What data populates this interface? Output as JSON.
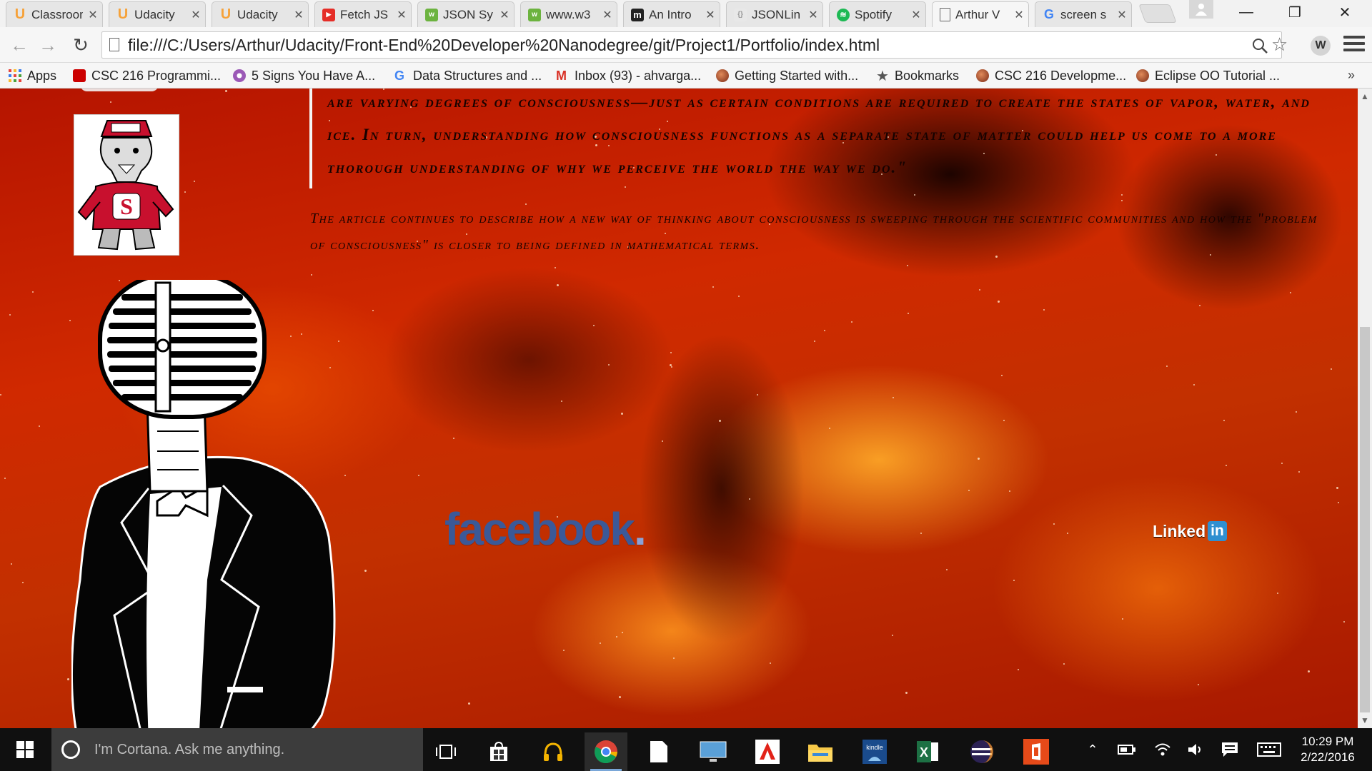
{
  "browser": {
    "tabs": [
      {
        "title": "Classroom",
        "icon": "udacity-icon",
        "color": "#f6a23a"
      },
      {
        "title": "Udacity",
        "icon": "udacity-icon",
        "color": "#f6a23a"
      },
      {
        "title": "Udacity",
        "icon": "udacity-icon",
        "color": "#f6a23a"
      },
      {
        "title": "Fetch JS",
        "icon": "youtube-icon",
        "color": "#e52d27"
      },
      {
        "title": "JSON Sy",
        "icon": "w3schools-icon",
        "color": "#6cb33f"
      },
      {
        "title": "www.w3",
        "icon": "w3schools-icon",
        "color": "#6cb33f"
      },
      {
        "title": "An Intro",
        "icon": "medium-icon",
        "color": "#222222"
      },
      {
        "title": "JSONLin",
        "icon": "jsonlint-icon",
        "color": "#cfcfcf"
      },
      {
        "title": "Spotify",
        "icon": "spotify-icon",
        "color": "#1db954"
      },
      {
        "title": "Arthur V",
        "icon": "page-icon",
        "color": "#ffffff",
        "active": true
      },
      {
        "title": "screen s",
        "icon": "google-icon",
        "color": "#4285f4"
      }
    ],
    "url": "file:///C:/Users/Arthur/Udacity/Front-End%20Developer%20Nanodegree/git/Project1/Portfolio/index.html",
    "bookmarks": [
      {
        "label": "Apps",
        "icon": "apps-grid-icon",
        "color": "#e8453c"
      },
      {
        "label": "CSC 216 Programmi...",
        "icon": "ncsu-icon",
        "color": "#cc0000"
      },
      {
        "label": "5 Signs You Have A...",
        "icon": "flower-icon",
        "color": "#9b59b6"
      },
      {
        "label": "Data Structures and ...",
        "icon": "google-icon",
        "color": "#4285f4"
      },
      {
        "label": "Inbox (93) - ahvarga...",
        "icon": "gmail-icon",
        "color": "#d93025"
      },
      {
        "label": "Getting Started with...",
        "icon": "site-icon",
        "color": "#b34a2a"
      },
      {
        "label": "Bookmarks",
        "icon": "star-icon",
        "color": "#555555"
      },
      {
        "label": "CSC 216 Developme...",
        "icon": "site-icon",
        "color": "#b34a2a"
      },
      {
        "label": "Eclipse OO Tutorial ...",
        "icon": "site-icon",
        "color": "#b34a2a"
      }
    ],
    "more_bookmarks": "»"
  },
  "page": {
    "quote": "are varying degrees of consciousness—just as certain conditions are required to create the states of vapor, water, and ice. In turn, understanding how consciousness functions as a separate state of matter could help us come to a more thorough understanding of why we perceive the world the way we do.\"",
    "paragraph": "The article continues to describe how a new way of thinking about consciousness is sweeping through the scientific communities and how the \"problem of consciousness\" is closer to being defined in mathematical terms.",
    "facebook": {
      "word": "facebook",
      "dot": "."
    },
    "linkedin": {
      "text": "Linked",
      "box": "in"
    },
    "colors": {
      "facebook": "#3b5998",
      "linkedin": "#2f8fd0",
      "nebula": "#c82400"
    }
  },
  "taskbar": {
    "cortana_placeholder": "I'm Cortana. Ask me anything.",
    "apps": [
      "task-view-icon",
      "store-icon",
      "headphones-icon",
      "chrome-icon",
      "file-icon",
      "lenovo-icon",
      "adobe-icon",
      "file-explorer-icon",
      "kindle-icon",
      "excel-icon",
      "eclipse-icon",
      "office-icon"
    ],
    "time": "10:29 PM",
    "date": "2/22/2016"
  }
}
